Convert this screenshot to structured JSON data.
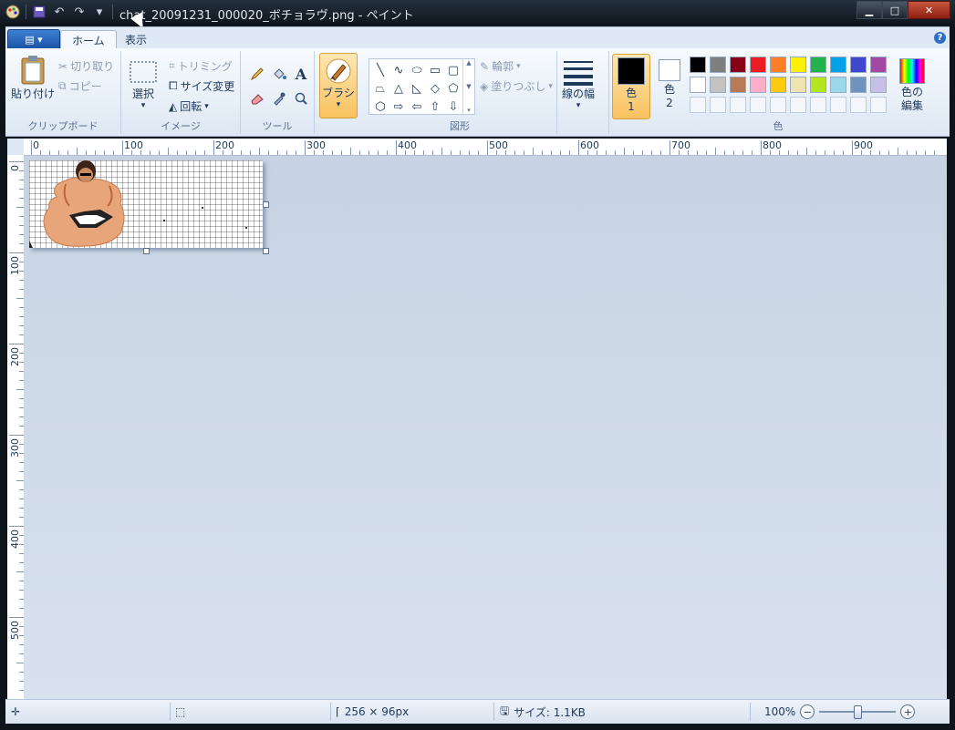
{
  "window": {
    "title": "chat_20091231_000020_ボチョラヴ.png - ペイント",
    "controls": {
      "minimize": "▁",
      "maximize": "□",
      "close": "✕"
    }
  },
  "ribbon_tabs": {
    "file_label": "▤ ▾",
    "tabs": [
      "ホーム",
      "表示"
    ],
    "active_tab": "ホーム"
  },
  "clipboard": {
    "paste": "貼り付け",
    "cut": "切り取り",
    "copy": "コピー",
    "group": "クリップボード"
  },
  "image": {
    "select": "選択",
    "crop": "トリミング",
    "resize": "サイズ変更",
    "rotate": "回転",
    "group": "イメージ"
  },
  "tools": {
    "group": "ツール",
    "text_glyph": "A"
  },
  "brush": {
    "label": "ブラシ"
  },
  "shapes": {
    "outline": "輪郭",
    "fill": "塗りつぶし",
    "group": "図形"
  },
  "size": {
    "label": "線の幅"
  },
  "colors": {
    "color1_line1": "色",
    "color1_line2": "1",
    "color2_line1": "色",
    "color2_line2": "2",
    "edit_line1": "色の",
    "edit_line2": "編集",
    "group": "色",
    "color1_value": "#000000",
    "color2_value": "#ffffff",
    "palette_row1": [
      "#000000",
      "#7f7f7f",
      "#880015",
      "#ed1c24",
      "#ff7f27",
      "#fff200",
      "#22b14c",
      "#00a2e8",
      "#3f48cc",
      "#a349a4"
    ],
    "palette_row2": [
      "#ffffff",
      "#c3c3c3",
      "#b97a57",
      "#ffaec9",
      "#ffc90e",
      "#efe4b0",
      "#b5e61d",
      "#99d9ea",
      "#7092be",
      "#c8bfe7"
    ]
  },
  "ruler": {
    "h_labels": [
      "0",
      "100",
      "200",
      "300",
      "400",
      "500",
      "600",
      "700",
      "800",
      "900"
    ],
    "v_labels": [
      "0",
      "100",
      "200",
      "300",
      "400",
      "500"
    ]
  },
  "status": {
    "dimensions": "256 × 96px",
    "filesize": "サイズ: 1.1KB",
    "zoom": "100%",
    "zoom_level": 100
  }
}
